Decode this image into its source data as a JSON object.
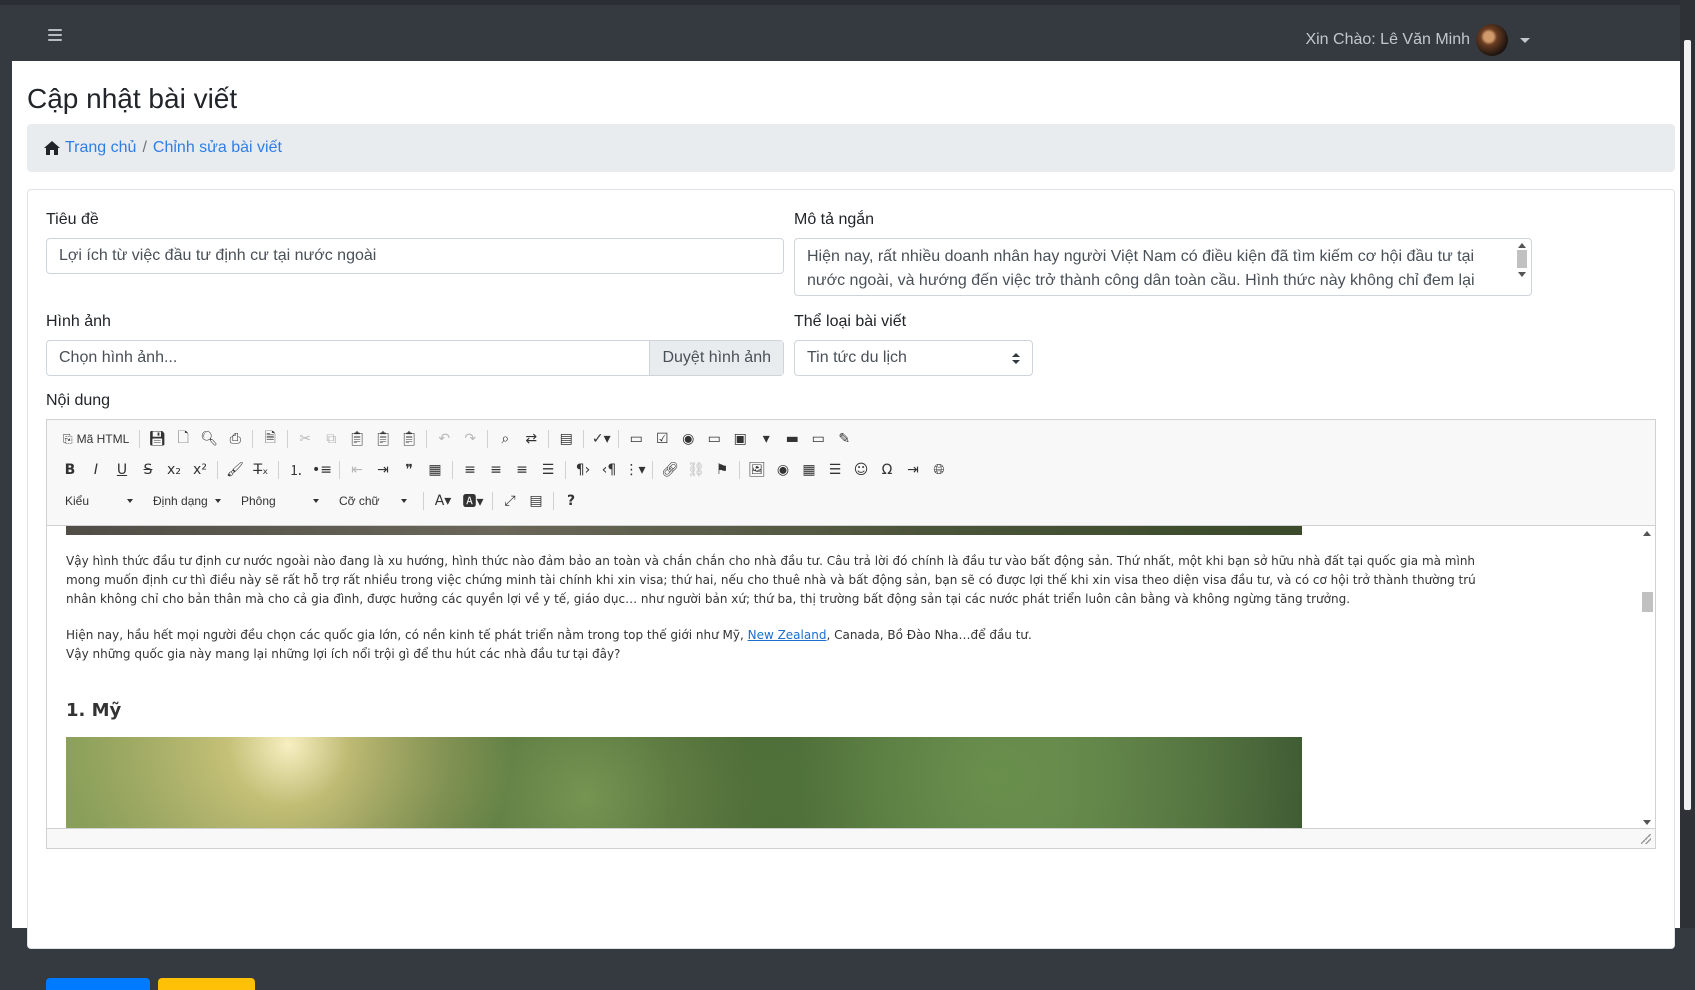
{
  "navbar": {
    "greeting": "Xin Chào: Lê Văn Minh"
  },
  "page": {
    "title": "Cập nhật bài viết"
  },
  "breadcrumb": {
    "home": "Trang chủ",
    "separator": "/",
    "current": "Chỉnh sửa bài viết"
  },
  "form": {
    "title_label": "Tiêu đề",
    "title_value": "Lợi ích từ việc đầu tư định cư tại nước ngoài",
    "desc_label": "Mô tả ngắn",
    "desc_value": "Hiện nay, rất nhiều doanh nhân hay người Việt Nam có điều kiện đã tìm kiếm cơ hội đầu tư tại nước ngoài, và hướng đến việc trở thành công dân toàn cầu. Hình thức này không chỉ đem lại nguồn lợi nhuận hấp",
    "image_label": "Hình ảnh",
    "image_placeholder": "Chọn hình ảnh...",
    "image_button": "Duyệt hình ảnh",
    "category_label": "Thể loại bài viết",
    "category_value": "Tin tức du lịch",
    "content_label": "Nội dung"
  },
  "editor": {
    "source_button": "Mã HTML",
    "styles_combo": "Kiểu",
    "format_combo": "Định dạng",
    "font_combo": "Phông",
    "size_combo": "Cỡ chữ",
    "help": "?",
    "paragraph1": "Vậy hình thức đầu tư định cư nước ngoài nào đang là xu hướng, hình thức nào đảm bảo an toàn và chắn chắn cho nhà đầu tư. Câu trả lời đó chính là đầu tư vào bất động sản. Thứ nhất, một khi bạn sở hữu nhà đất tại quốc gia mà mình mong muốn định cư thì điều này sẽ rất hỗ trợ rất nhiều trong việc chứng minh tài chính khi xin visa; thứ hai, nếu cho thuê nhà và bất động sản, bạn sẽ có được lợi thế khi xin visa theo diện visa đầu tư, và có cơ hội trở thành thường trú nhân không chỉ cho bản thân mà cho cả gia đình, được hưởng các quyền lợi về y tế, giáo dục… như người bản xứ; thứ ba, thị trường bất động sản tại các nước phát triển luôn cân bằng và không ngừng tăng trưởng.",
    "paragraph2_before": "Hiện nay, hầu hết mọi người đều chọn các quốc gia lớn, có nền kinh tế phát triển nằm trong top thế giới như Mỹ, ",
    "paragraph2_link": "New Zealand",
    "paragraph2_after": ", Canada, Bồ Đào Nha…để đầu tư.",
    "paragraph3": "Vậy những quốc gia này mang lại những lợi ích nổi trội gì để thu hút các nhà đầu tư tại đây?",
    "heading1": "1. Mỹ"
  },
  "colors": {
    "navbar": "#343a40",
    "link": "#2f7ee6",
    "primary_button": "#007bff",
    "warning_button": "#ffc107",
    "dark_button": "#343a40"
  }
}
